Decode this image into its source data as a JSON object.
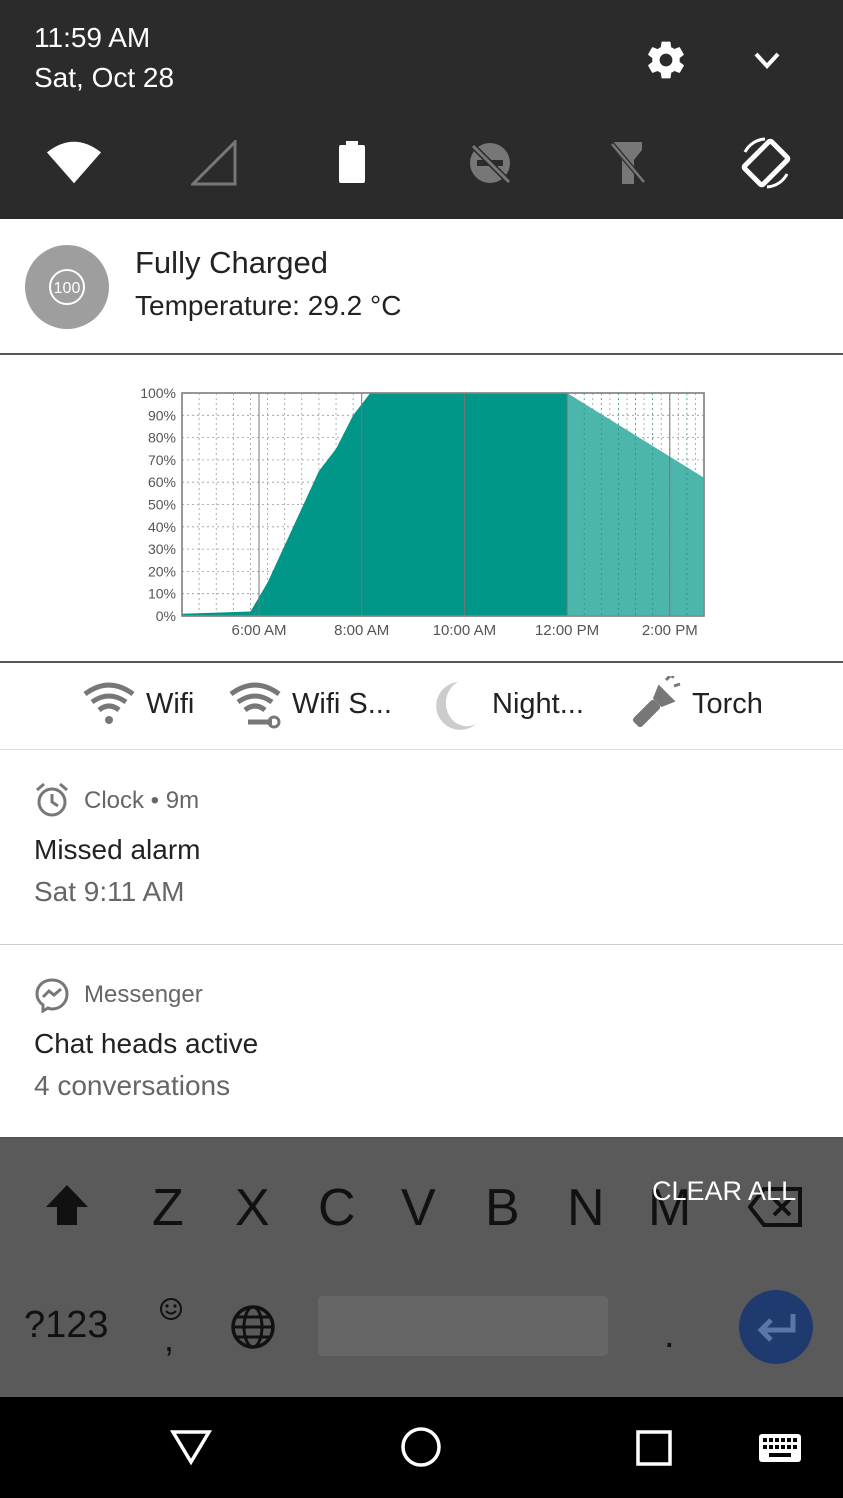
{
  "status": {
    "time": "11:59 AM",
    "date": "Sat, Oct 28"
  },
  "quick_settings_icons": [
    "wifi-icon",
    "cell-signal-icon",
    "battery-icon",
    "do-not-disturb-icon",
    "flashlight-icon",
    "auto-rotate-icon"
  ],
  "battery_notification": {
    "badge": "100",
    "title": "Fully Charged",
    "temperature": "Temperature: 29.2 °C"
  },
  "chart_data": {
    "type": "area",
    "y_ticks": [
      "100%",
      "90%",
      "80%",
      "70%",
      "60%",
      "50%",
      "40%",
      "30%",
      "20%",
      "10%",
      "0%"
    ],
    "x_ticks": [
      "6:00 AM",
      "8:00 AM",
      "10:00 AM",
      "12:00 PM",
      "2:00 PM"
    ],
    "ylim": [
      0,
      100
    ],
    "colors": {
      "charging": "#009688",
      "discharging": "#4db6ac"
    },
    "series": [
      {
        "x": [
          "4:30 AM",
          "5:50 AM",
          "6:10 AM",
          "6:40 AM",
          "7:10 AM",
          "7:30 AM",
          "7:50 AM",
          "8:10 AM",
          "12:00 PM"
        ],
        "y": [
          1,
          2,
          15,
          40,
          65,
          75,
          90,
          100,
          100
        ]
      },
      {
        "x": [
          "12:00 PM",
          "2:40 PM"
        ],
        "y": [
          100,
          62
        ]
      }
    ]
  },
  "toggles": [
    {
      "label": "Wifi",
      "icon": "wifi-icon"
    },
    {
      "label": "Wifi S...",
      "icon": "wifi-settings-icon"
    },
    {
      "label": "Night...",
      "icon": "moon-icon"
    },
    {
      "label": "Torch",
      "icon": "torch-icon"
    }
  ],
  "notifications": [
    {
      "app": "Clock • 9m",
      "title": "Missed alarm",
      "subtitle": "Sat 9:11 AM",
      "icon": "alarm-clock-icon"
    },
    {
      "app": "Messenger",
      "title": "Chat heads active",
      "subtitle": "4 conversations",
      "icon": "messenger-icon"
    }
  ],
  "clear_all": "CLEAR ALL",
  "keyboard": {
    "row3": [
      "Z",
      "X",
      "C",
      "V",
      "B",
      "N",
      "M"
    ],
    "symbols_key": "?123",
    "comma_key": ",",
    "period_key": "."
  },
  "nav_icons": [
    "back-icon",
    "home-icon",
    "recents-icon",
    "keyboard-icon"
  ]
}
